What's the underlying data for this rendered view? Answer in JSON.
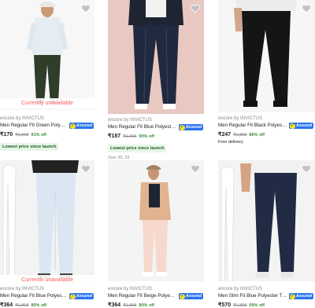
{
  "colors": {
    "unavailable": "#ff5a5a",
    "assured_blue": "#2874f0",
    "discount_green": "#388e3c",
    "heart_grey": "#c2c2c2"
  },
  "products": [
    {
      "unavailable": "Currently unavailable",
      "brand": "encore by INVICTUS",
      "title": "Men Regular Fit Green Polyester ...",
      "assured": "Assured",
      "price": "₹170",
      "mrp": "₹1,998",
      "off": "91% off",
      "tag": "Lowest price since launch",
      "extra": ""
    },
    {
      "unavailable": "",
      "brand": "encore by INVICTUS",
      "title": "Men Regular Fit Blue Polyester T...",
      "assured": "Assured",
      "price": "₹187",
      "mrp": "₹1,998",
      "off": "90% off",
      "tag": "Lowest price since launch",
      "extra": "Size 30, 32"
    },
    {
      "unavailable": "",
      "brand": "encore by INVICTUS",
      "title": "Men Regular Fit Black Polyester ...",
      "assured": "Assured",
      "price": "₹247",
      "mrp": "₹1,898",
      "off": "86% off",
      "tag": "",
      "extra": "Free delivery"
    },
    {
      "unavailable": "Currently unavailable",
      "brand": "encore by INVICTUS",
      "title": "Men Regular Fit Blue Polyester T...",
      "assured": "Assured",
      "price": "₹364",
      "mrp": "₹1,898",
      "off": "80% off",
      "tag": "",
      "extra": ""
    },
    {
      "unavailable": "",
      "brand": "encore by INVICTUS",
      "title": "Men Regular Fit Beige Polyester ...",
      "assured": "Assured",
      "price": "₹364",
      "mrp": "₹1,898",
      "off": "80% off",
      "tag": "",
      "extra": ""
    },
    {
      "unavailable": "",
      "brand": "encore by INVICTUS",
      "title": "Men Slim Fit Blue Polyester Trou...",
      "assured": "Assured",
      "price": "₹570",
      "mrp": "₹1,898",
      "off": "69% off",
      "tag": "",
      "extra": ""
    }
  ]
}
